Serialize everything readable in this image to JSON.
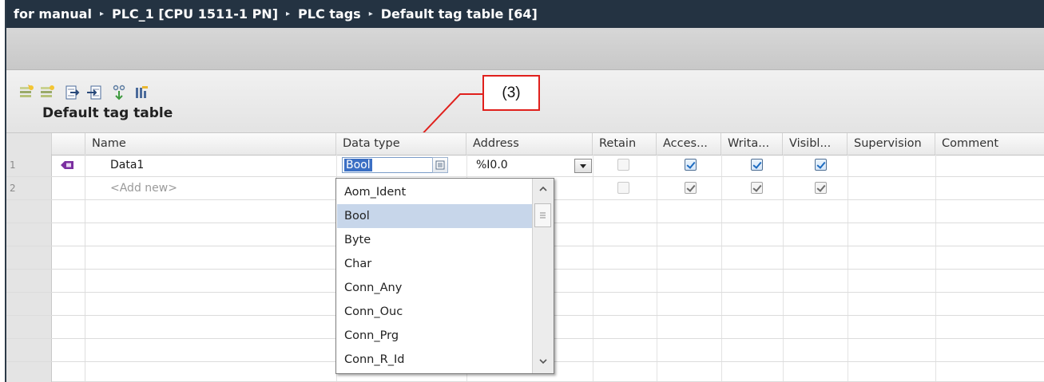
{
  "breadcrumb": [
    "for manual",
    "PLC_1 [CPU 1511-1 PN]",
    "PLC tags",
    "Default tag table [64]"
  ],
  "breadcrumb_separator": "▸",
  "toolbar": {
    "icons": [
      "add-row-icon",
      "insert-row-icon",
      "export-icon",
      "import-icon",
      "monitor-icon",
      "show-columns-icon"
    ]
  },
  "table": {
    "title": "Default tag table",
    "columns": [
      "Name",
      "Data type",
      "Address",
      "Retain",
      "Acces...",
      "Writa...",
      "Visibl...",
      "Supervision",
      "Comment"
    ],
    "rows": [
      {
        "num": "1",
        "name": "Data1",
        "data_type": "Bool",
        "address": "%I0.0",
        "retain": false,
        "accessible": true,
        "writable": true,
        "visible": true
      },
      {
        "num": "2",
        "name": "<Add new>",
        "data_type": "",
        "address": "",
        "retain": false,
        "accessible": true,
        "writable": true,
        "visible": true
      }
    ]
  },
  "dropdown": {
    "selected": "Bool",
    "options": [
      "Aom_Ident",
      "Bool",
      "Byte",
      "Char",
      "Conn_Any",
      "Conn_Ouc",
      "Conn_Prg",
      "Conn_R_Id"
    ]
  },
  "annotation": {
    "label": "(3)"
  },
  "colors": {
    "title_bar": "#243342",
    "selection": "#c7d6ea",
    "checkbox_check": "#1c6bc0",
    "annotation": "#e0201c"
  }
}
